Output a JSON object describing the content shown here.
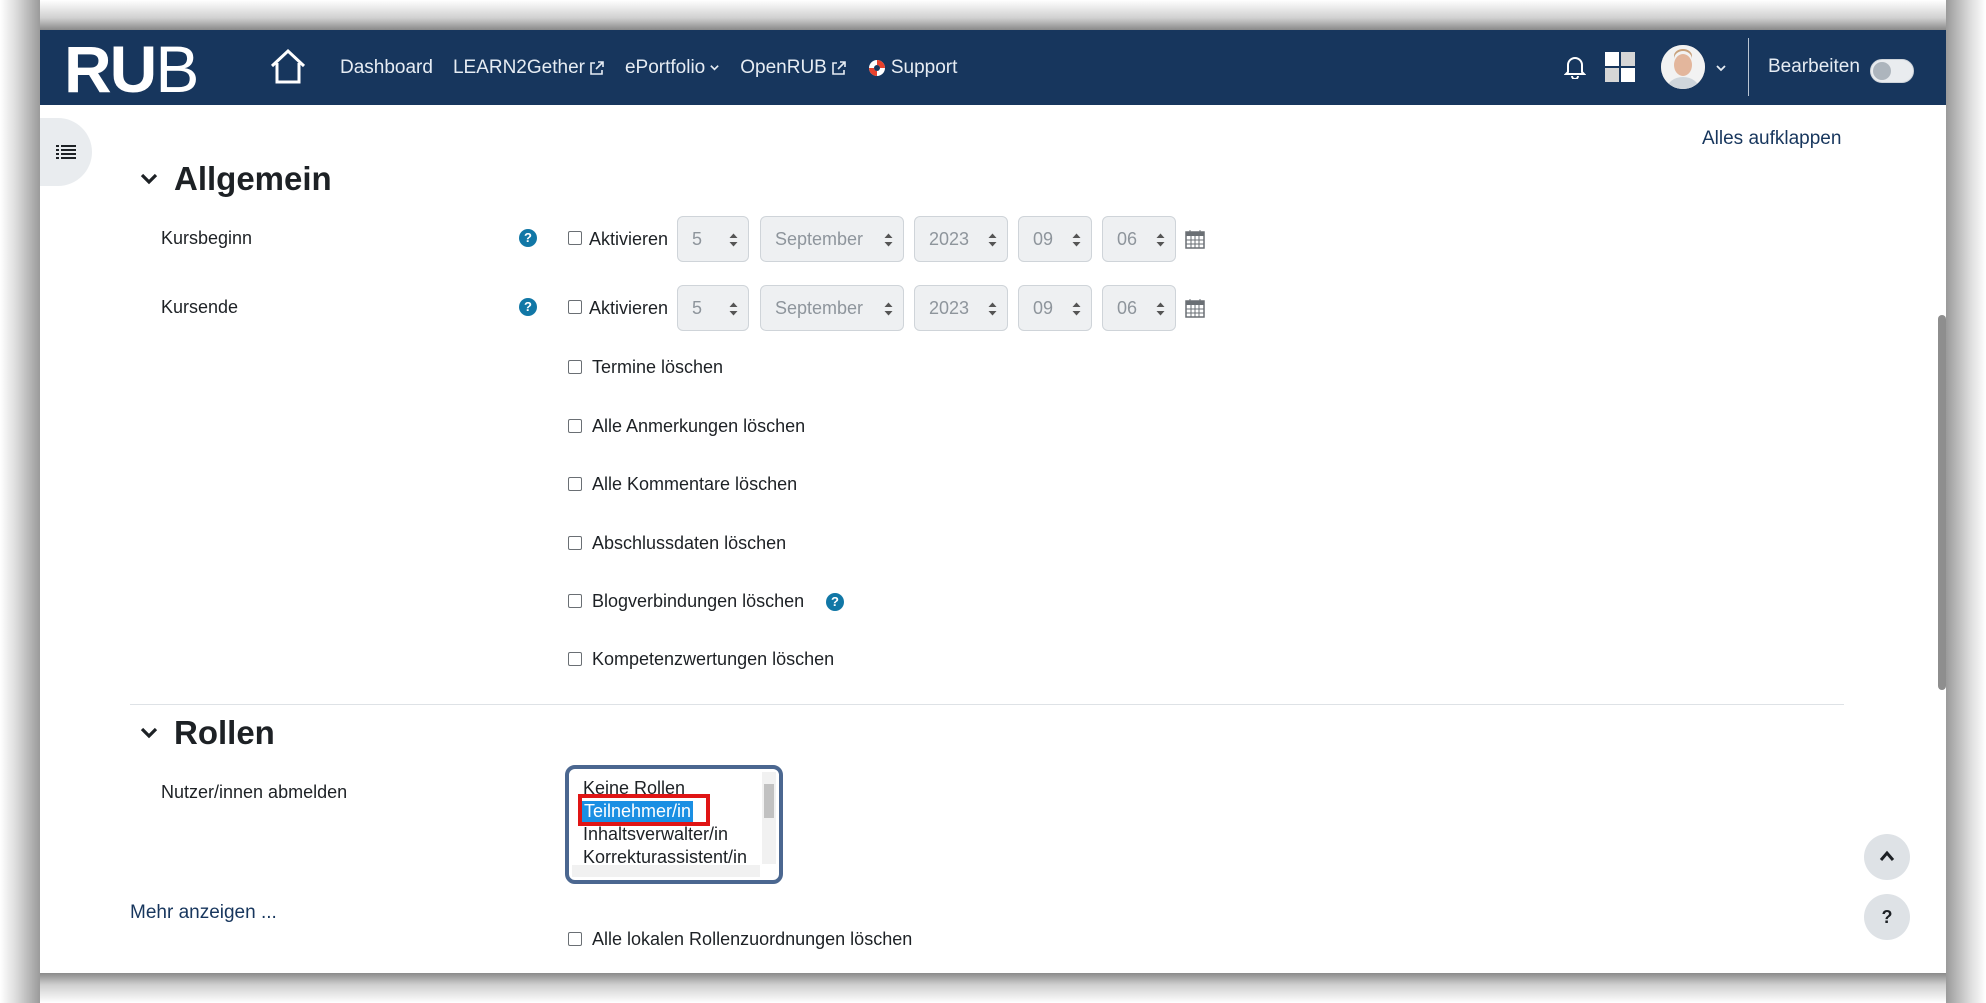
{
  "navbar": {
    "logo_text": "RU",
    "logo_b": "B",
    "links": [
      {
        "label": "Dashboard"
      },
      {
        "label": "LEARN2Gether"
      },
      {
        "label": "ePortfolio"
      },
      {
        "label": "OpenRUB"
      },
      {
        "label": "Support"
      }
    ],
    "edit_label": "Bearbeiten"
  },
  "expand_all": "Alles aufklappen",
  "general": {
    "title": "Allgemein",
    "course_start": {
      "label": "Kursbeginn",
      "enable_label": "Aktivieren",
      "day": "5",
      "month": "September",
      "year": "2023",
      "hour": "09",
      "minute": "06"
    },
    "course_end": {
      "label": "Kursende",
      "enable_label": "Aktivieren",
      "day": "5",
      "month": "September",
      "year": "2023",
      "hour": "09",
      "minute": "06"
    },
    "options": [
      "Termine löschen",
      "Alle Anmerkungen löschen",
      "Alle Kommentare löschen",
      "Abschlussdaten löschen",
      "Blogverbindungen löschen",
      "Kompetenzwertungen löschen"
    ]
  },
  "roles": {
    "title": "Rollen",
    "unenrol_label": "Nutzer/innen abmelden",
    "role_options": [
      "Keine Rollen",
      "Teilnehmer/in",
      "Inhaltsverwalter/in",
      "Korrekturassistent/in"
    ],
    "selected_role": "Teilnehmer/in",
    "more_link": "Mehr anzeigen ...",
    "local_roles_option": "Alle lokalen Rollenzuordnungen löschen"
  }
}
